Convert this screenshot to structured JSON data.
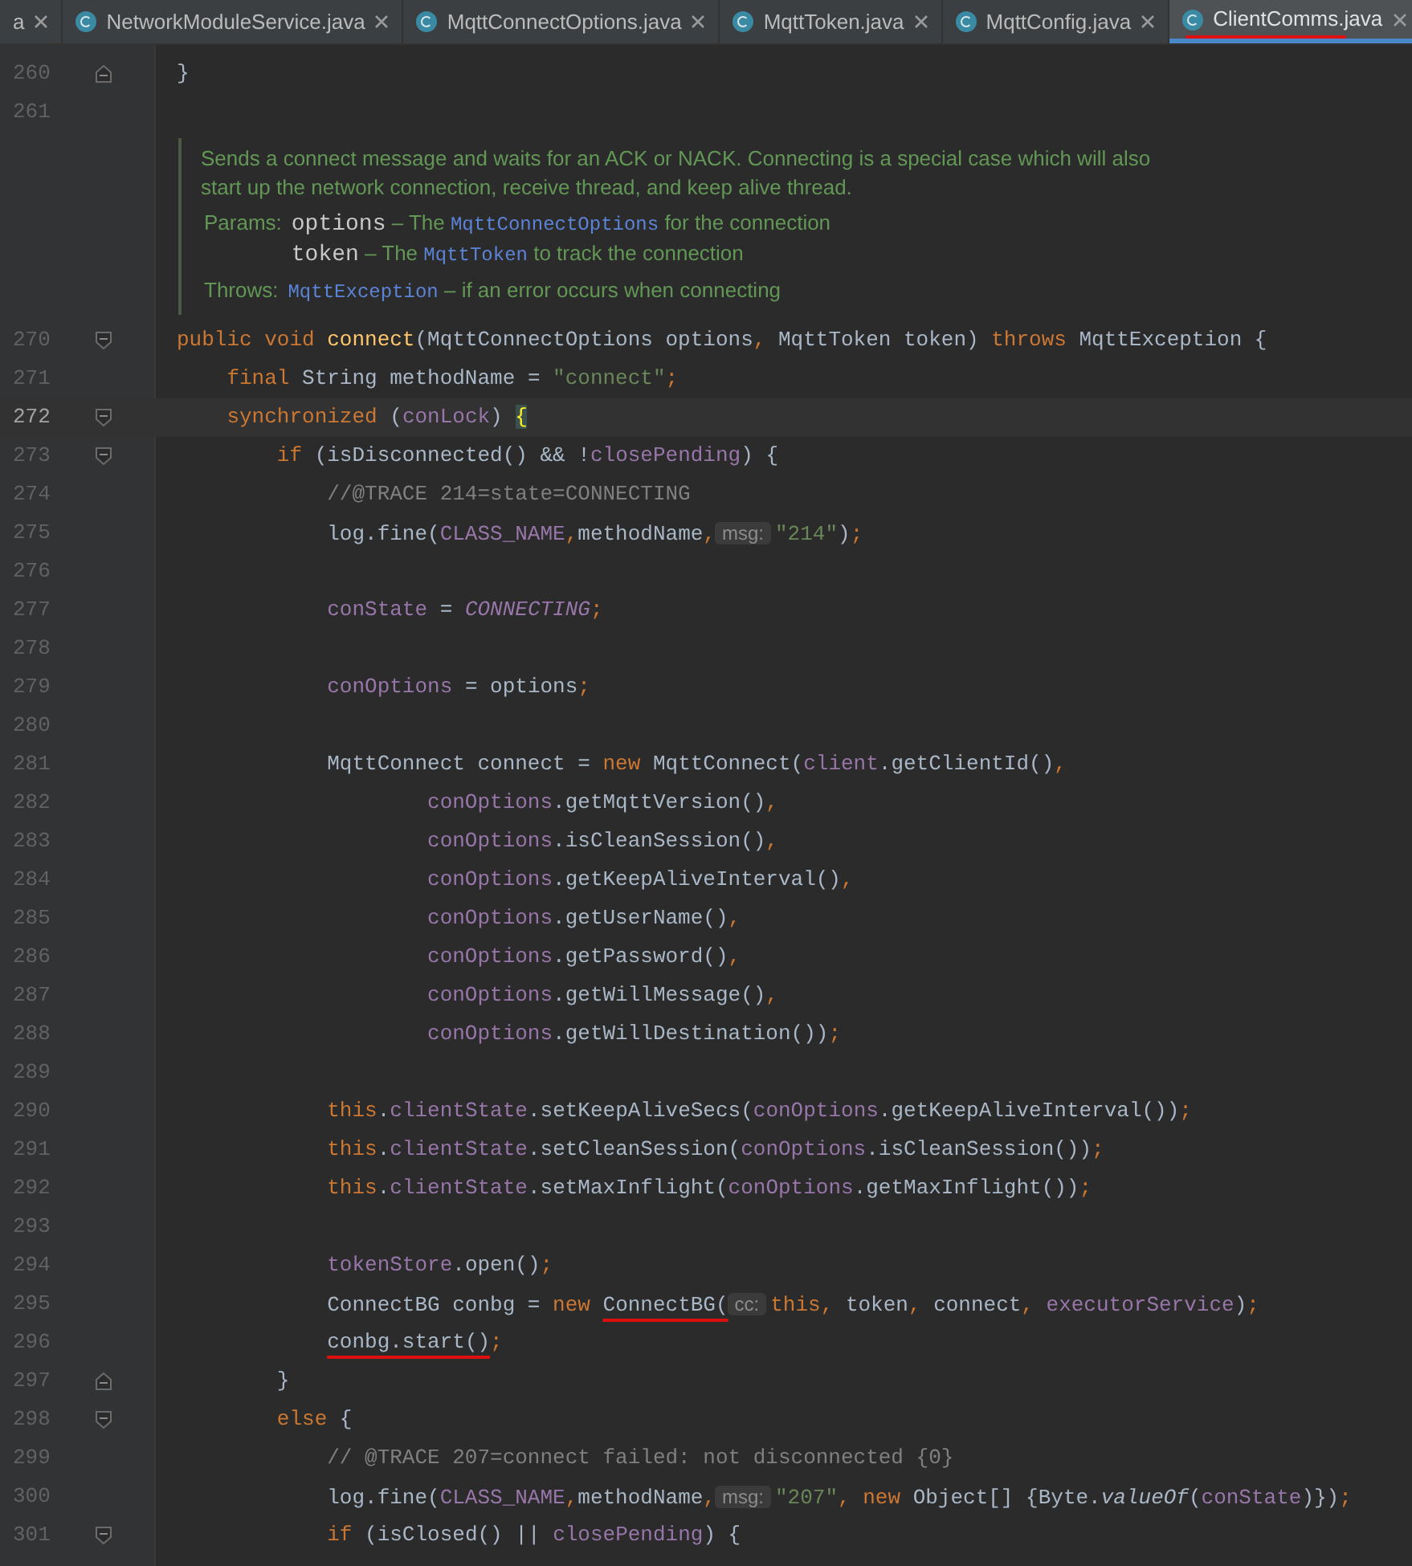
{
  "tabs": [
    {
      "label": "a",
      "icon": false,
      "selected": false,
      "red_underline": false
    },
    {
      "label": "NetworkModuleService.java",
      "icon": true,
      "selected": false,
      "red_underline": false
    },
    {
      "label": "MqttConnectOptions.java",
      "icon": true,
      "selected": false,
      "red_underline": false
    },
    {
      "label": "MqttToken.java",
      "icon": true,
      "selected": false,
      "red_underline": false
    },
    {
      "label": "MqttConfig.java",
      "icon": true,
      "selected": false,
      "red_underline": false
    },
    {
      "label": "ClientComms.java",
      "icon": true,
      "selected": true,
      "red_underline": true
    }
  ],
  "editor": {
    "lines_before_doc": [
      {
        "number": "260",
        "fold_start": false,
        "fold_end": true,
        "current": false,
        "tokens": [
          {
            "kind": "plain",
            "text": "}"
          }
        ]
      },
      {
        "number": "261",
        "fold_start": false,
        "fold_end": false,
        "current": false
      }
    ],
    "doc": {
      "summary": "Sends a connect message and waits for an ACK or NACK. Connecting is a special case which will also start up the network connection, receive thread, and keep alive thread.",
      "params_label": "Params:",
      "params": [
        {
          "name": "options",
          "before": " – The ",
          "ref": "MqttConnectOptions",
          "after": " for the connection"
        },
        {
          "name": "token",
          "before": " – The ",
          "ref": "MqttToken",
          "after": " to track the connection"
        }
      ],
      "throws_label": "Throws:",
      "throws": {
        "ref": "MqttException",
        "after": " – if an error occurs when connecting"
      }
    },
    "lines": [
      {
        "number": "270",
        "fold_start": true,
        "fold_end": false,
        "current": false,
        "tokens": [
          {
            "kind": "keyword",
            "text": "public void "
          },
          {
            "kind": "decl",
            "text": "connect"
          },
          {
            "kind": "plain",
            "text": "(MqttConnectOptions options"
          },
          {
            "kind": "keyword",
            "text": ", "
          },
          {
            "kind": "plain",
            "text": "MqttToken token) "
          },
          {
            "kind": "keyword",
            "text": "throws "
          },
          {
            "kind": "plain",
            "text": "MqttException {"
          }
        ]
      },
      {
        "number": "271",
        "fold_start": false,
        "fold_end": false,
        "current": false,
        "tokens": [
          {
            "kind": "keyword",
            "text": "    final "
          },
          {
            "kind": "plain",
            "text": "String methodName = "
          },
          {
            "kind": "string",
            "text": "\"connect\""
          },
          {
            "kind": "keyword",
            "text": ";"
          }
        ]
      },
      {
        "number": "272",
        "fold_start": true,
        "fold_end": false,
        "current": true,
        "tokens": [
          {
            "kind": "keyword",
            "text": "    synchronized "
          },
          {
            "kind": "plain",
            "text": "("
          },
          {
            "kind": "field",
            "text": "conLock"
          },
          {
            "kind": "plain",
            "text": ") "
          },
          {
            "kind": "brace",
            "text": "{"
          }
        ]
      },
      {
        "number": "273",
        "fold_start": true,
        "fold_end": false,
        "current": false,
        "tokens": [
          {
            "kind": "keyword",
            "text": "        if "
          },
          {
            "kind": "plain",
            "text": "(isDisconnected() && !"
          },
          {
            "kind": "field",
            "text": "closePending"
          },
          {
            "kind": "plain",
            "text": ") {"
          }
        ]
      },
      {
        "number": "274",
        "fold_start": false,
        "fold_end": false,
        "current": false,
        "tokens": [
          {
            "kind": "comment",
            "text": "            //@TRACE 214=state=CONNECTING"
          }
        ]
      },
      {
        "number": "275",
        "fold_start": false,
        "fold_end": false,
        "current": false,
        "tokens": [
          {
            "kind": "plain",
            "text": "            log.fine("
          },
          {
            "kind": "field",
            "text": "CLASS_NAME"
          },
          {
            "kind": "keyword",
            "text": ","
          },
          {
            "kind": "plain",
            "text": "methodName"
          },
          {
            "kind": "keyword",
            "text": ","
          },
          {
            "kind": "hint",
            "text": "msg:"
          },
          {
            "kind": "string",
            "text": "\"214\""
          },
          {
            "kind": "plain",
            "text": ")"
          },
          {
            "kind": "keyword",
            "text": ";"
          }
        ]
      },
      {
        "number": "276",
        "fold_start": false,
        "fold_end": false,
        "current": false
      },
      {
        "number": "277",
        "fold_start": false,
        "fold_end": false,
        "current": false,
        "tokens": [
          {
            "kind": "field",
            "text": "            conState"
          },
          {
            "kind": "plain",
            "text": " = "
          },
          {
            "kind": "static",
            "text": "CONNECTING"
          },
          {
            "kind": "keyword",
            "text": ";"
          }
        ]
      },
      {
        "number": "278",
        "fold_start": false,
        "fold_end": false,
        "current": false
      },
      {
        "number": "279",
        "fold_start": false,
        "fold_end": false,
        "current": false,
        "tokens": [
          {
            "kind": "field",
            "text": "            conOptions"
          },
          {
            "kind": "plain",
            "text": " = options"
          },
          {
            "kind": "keyword",
            "text": ";"
          }
        ]
      },
      {
        "number": "280",
        "fold_start": false,
        "fold_end": false,
        "current": false
      },
      {
        "number": "281",
        "fold_start": false,
        "fold_end": false,
        "current": false,
        "tokens": [
          {
            "kind": "plain",
            "text": "            MqttConnect connect = "
          },
          {
            "kind": "keyword",
            "text": "new "
          },
          {
            "kind": "plain",
            "text": "MqttConnect("
          },
          {
            "kind": "field",
            "text": "client"
          },
          {
            "kind": "plain",
            "text": ".getClientId()"
          },
          {
            "kind": "keyword",
            "text": ","
          }
        ]
      },
      {
        "number": "282",
        "fold_start": false,
        "fold_end": false,
        "current": false,
        "tokens": [
          {
            "kind": "field",
            "text": "                    conOptions"
          },
          {
            "kind": "plain",
            "text": ".getMqttVersion()"
          },
          {
            "kind": "keyword",
            "text": ","
          }
        ]
      },
      {
        "number": "283",
        "fold_start": false,
        "fold_end": false,
        "current": false,
        "tokens": [
          {
            "kind": "field",
            "text": "                    conOptions"
          },
          {
            "kind": "plain",
            "text": ".isCleanSession()"
          },
          {
            "kind": "keyword",
            "text": ","
          }
        ]
      },
      {
        "number": "284",
        "fold_start": false,
        "fold_end": false,
        "current": false,
        "tokens": [
          {
            "kind": "field",
            "text": "                    conOptions"
          },
          {
            "kind": "plain",
            "text": ".getKeepAliveInterval()"
          },
          {
            "kind": "keyword",
            "text": ","
          }
        ]
      },
      {
        "number": "285",
        "fold_start": false,
        "fold_end": false,
        "current": false,
        "tokens": [
          {
            "kind": "field",
            "text": "                    conOptions"
          },
          {
            "kind": "plain",
            "text": ".getUserName()"
          },
          {
            "kind": "keyword",
            "text": ","
          }
        ]
      },
      {
        "number": "286",
        "fold_start": false,
        "fold_end": false,
        "current": false,
        "tokens": [
          {
            "kind": "field",
            "text": "                    conOptions"
          },
          {
            "kind": "plain",
            "text": ".getPassword()"
          },
          {
            "kind": "keyword",
            "text": ","
          }
        ]
      },
      {
        "number": "287",
        "fold_start": false,
        "fold_end": false,
        "current": false,
        "tokens": [
          {
            "kind": "field",
            "text": "                    conOptions"
          },
          {
            "kind": "plain",
            "text": ".getWillMessage()"
          },
          {
            "kind": "keyword",
            "text": ","
          }
        ]
      },
      {
        "number": "288",
        "fold_start": false,
        "fold_end": false,
        "current": false,
        "tokens": [
          {
            "kind": "field",
            "text": "                    conOptions"
          },
          {
            "kind": "plain",
            "text": ".getWillDestination())"
          },
          {
            "kind": "keyword",
            "text": ";"
          }
        ]
      },
      {
        "number": "289",
        "fold_start": false,
        "fold_end": false,
        "current": false
      },
      {
        "number": "290",
        "fold_start": false,
        "fold_end": false,
        "current": false,
        "tokens": [
          {
            "kind": "keyword",
            "text": "            this"
          },
          {
            "kind": "plain",
            "text": "."
          },
          {
            "kind": "field",
            "text": "clientState"
          },
          {
            "kind": "plain",
            "text": ".setKeepAliveSecs("
          },
          {
            "kind": "field",
            "text": "conOptions"
          },
          {
            "kind": "plain",
            "text": ".getKeepAliveInterval())"
          },
          {
            "kind": "keyword",
            "text": ";"
          }
        ]
      },
      {
        "number": "291",
        "fold_start": false,
        "fold_end": false,
        "current": false,
        "tokens": [
          {
            "kind": "keyword",
            "text": "            this"
          },
          {
            "kind": "plain",
            "text": "."
          },
          {
            "kind": "field",
            "text": "clientState"
          },
          {
            "kind": "plain",
            "text": ".setCleanSession("
          },
          {
            "kind": "field",
            "text": "conOptions"
          },
          {
            "kind": "plain",
            "text": ".isCleanSession())"
          },
          {
            "kind": "keyword",
            "text": ";"
          }
        ]
      },
      {
        "number": "292",
        "fold_start": false,
        "fold_end": false,
        "current": false,
        "tokens": [
          {
            "kind": "keyword",
            "text": "            this"
          },
          {
            "kind": "plain",
            "text": "."
          },
          {
            "kind": "field",
            "text": "clientState"
          },
          {
            "kind": "plain",
            "text": ".setMaxInflight("
          },
          {
            "kind": "field",
            "text": "conOptions"
          },
          {
            "kind": "plain",
            "text": ".getMaxInflight())"
          },
          {
            "kind": "keyword",
            "text": ";"
          }
        ]
      },
      {
        "number": "293",
        "fold_start": false,
        "fold_end": false,
        "current": false
      },
      {
        "number": "294",
        "fold_start": false,
        "fold_end": false,
        "current": false,
        "tokens": [
          {
            "kind": "field",
            "text": "            tokenStore"
          },
          {
            "kind": "plain",
            "text": ".open()"
          },
          {
            "kind": "keyword",
            "text": ";"
          }
        ]
      },
      {
        "number": "295",
        "fold_start": false,
        "fold_end": false,
        "current": false,
        "tokens": [
          {
            "kind": "plain",
            "text": "            ConnectBG conbg = "
          },
          {
            "kind": "keyword",
            "text": "new "
          },
          {
            "kind": "marked",
            "text": "ConnectBG("
          },
          {
            "kind": "hint",
            "text": "cc:"
          },
          {
            "kind": "keyword",
            "text": "this, "
          },
          {
            "kind": "plain",
            "text": "token"
          },
          {
            "kind": "keyword",
            "text": ", "
          },
          {
            "kind": "plain",
            "text": "connect"
          },
          {
            "kind": "keyword",
            "text": ", "
          },
          {
            "kind": "field",
            "text": "executorService"
          },
          {
            "kind": "plain",
            "text": ")"
          },
          {
            "kind": "keyword",
            "text": ";"
          }
        ]
      },
      {
        "number": "296",
        "fold_start": false,
        "fold_end": false,
        "current": false,
        "tokens": [
          {
            "kind": "marked",
            "text": "            conbg.start()"
          },
          {
            "kind": "keyword",
            "text": ";"
          }
        ]
      },
      {
        "number": "297",
        "fold_start": false,
        "fold_end": true,
        "current": false,
        "tokens": [
          {
            "kind": "plain",
            "text": "        }"
          }
        ]
      },
      {
        "number": "298",
        "fold_start": true,
        "fold_end": false,
        "current": false,
        "tokens": [
          {
            "kind": "keyword",
            "text": "        else "
          },
          {
            "kind": "plain",
            "text": "{"
          }
        ]
      },
      {
        "number": "299",
        "fold_start": false,
        "fold_end": false,
        "current": false,
        "tokens": [
          {
            "kind": "comment",
            "text": "            // @TRACE 207=connect failed: not disconnected {0}"
          }
        ]
      },
      {
        "number": "300",
        "fold_start": false,
        "fold_end": false,
        "current": false,
        "tokens": [
          {
            "kind": "plain",
            "text": "            log.fine("
          },
          {
            "kind": "field",
            "text": "CLASS_NAME"
          },
          {
            "kind": "keyword",
            "text": ","
          },
          {
            "kind": "plain",
            "text": "methodName"
          },
          {
            "kind": "keyword",
            "text": ","
          },
          {
            "kind": "hint",
            "text": "msg:"
          },
          {
            "kind": "string",
            "text": "\"207\""
          },
          {
            "kind": "keyword",
            "text": ", new "
          },
          {
            "kind": "plain",
            "text": "Object[] {Byte."
          },
          {
            "kind": "static_method",
            "text": "valueOf"
          },
          {
            "kind": "plain",
            "text": "("
          },
          {
            "kind": "field",
            "text": "conState"
          },
          {
            "kind": "plain",
            "text": ")})"
          },
          {
            "kind": "keyword",
            "text": ";"
          }
        ]
      },
      {
        "number": "301",
        "fold_start": true,
        "fold_end": false,
        "current": false,
        "tokens": [
          {
            "kind": "keyword",
            "text": "            if "
          },
          {
            "kind": "plain",
            "text": "(isClosed() || "
          },
          {
            "kind": "field",
            "text": "closePending"
          },
          {
            "kind": "plain",
            "text": ") {"
          }
        ]
      }
    ]
  }
}
